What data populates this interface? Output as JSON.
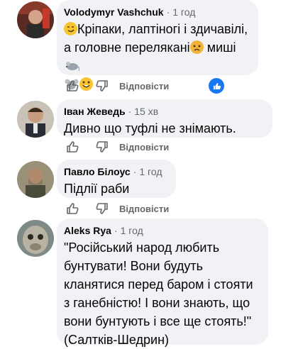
{
  "comments": [
    {
      "author": "Volodymyr Vashchuk",
      "time": "1 год",
      "line1": "Кріпаки, лаптіногі і здичавілі,",
      "line2a": "а головне перелякані",
      "line2b": " миші ",
      "reply_label": "Відповісти",
      "icons": [
        "smirk-emoji-icon",
        "sad-emoji-icon",
        "mouse-icon",
        "smile-emoji-icon"
      ]
    },
    {
      "author": "Іван Жеведь",
      "time": "15 хв",
      "text": "Дивно що туфлі не знімають.",
      "reply_label": "Відповісти"
    },
    {
      "author": "Павло Білоус",
      "time": "1 год",
      "text": "Підлії раби",
      "reply_label": "Відповісти"
    },
    {
      "author": "Aleks Rya",
      "time": "1 год",
      "text_lines": [
        "\"Російський народ любить",
        "бунтувати! Вони будуть",
        "кланятися перед баром і стояти",
        "з ганебністю! І вони знають, що",
        "вони бунтують і все ще стоять!\"",
        "(Салтків-Шедрин)"
      ]
    }
  ],
  "separator": "·",
  "colors": {
    "bubble": "#f0f2f5",
    "meta": "#65676b",
    "accent": "#1877f2"
  }
}
